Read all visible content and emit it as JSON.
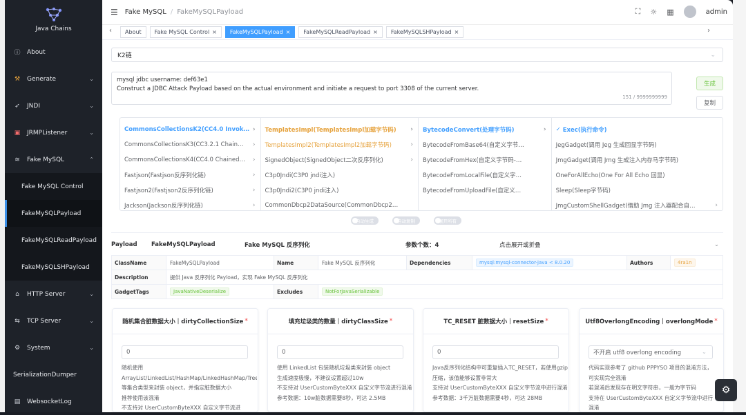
{
  "app": {
    "name": "Java Chains"
  },
  "sidebar": {
    "items": [
      {
        "label": "About",
        "icon": "info-circle-icon"
      },
      {
        "label": "Generate",
        "icon": "hammer-icon"
      },
      {
        "label": "JNDI",
        "icon": "rocket-icon"
      },
      {
        "label": "JRMPListener",
        "icon": "doc-icon"
      },
      {
        "label": "Fake MySQL",
        "icon": "mysql-icon"
      }
    ],
    "fake_mysql_sub": [
      "Fake MySQL Control",
      "FakeMySQLPayload",
      "FakeMySQLReadPayload",
      "FakeMySQLSHPayload"
    ],
    "items2": [
      {
        "label": "HTTP Server",
        "icon": "server-icon"
      },
      {
        "label": "TCP Server",
        "icon": "tcp-icon"
      },
      {
        "label": "System",
        "icon": "gear-icon"
      }
    ],
    "serialization": "SerializationDumper",
    "websocket": "WebsocketLog"
  },
  "header": {
    "crumb1": "Fake MySQL",
    "sep": "/",
    "crumb2": "FakeMySQLPayload",
    "user": "admin"
  },
  "tabs": [
    {
      "label": "About",
      "closable": false
    },
    {
      "label": "Fake MySQL Control",
      "closable": true
    },
    {
      "label": "FakeMySQLPayload",
      "closable": true
    },
    {
      "label": "FakeMySQLReadPayload",
      "closable": true
    },
    {
      "label": "FakeMySQLSHPayload",
      "closable": true
    }
  ],
  "chain_select": "K2链",
  "textarea": {
    "line1": "mysql jdbc username: def63e1",
    "line2": "Construct a JDBC Attack Payload based on the actual environment and initiate a request to port 3308 of the current server.",
    "counter": "151 / 9999999999"
  },
  "buttons": {
    "generate": "生成",
    "copy": "复制"
  },
  "cascader": {
    "col1": [
      "CommonsCollectionsK2(CC4.0 Invok…",
      "CommonsCollectionsK3(CC3.2.1 Chain…",
      "CommonsCollectionsK4(CC4.0 Chained…",
      "Fastjson(Fastjson反序列化链)",
      "Fastjson2(Fastjson2反序列化链)",
      "Jackson(Jackson反序列化链)"
    ],
    "col2": [
      "TemplatesImpl(TemplatesImpl加载字节码)",
      "TemplatesImpl2(TemplatesImpl2加载字节码)",
      "SignedObject(SignedObject二次反序列化)",
      "C3p0Jndi(C3P0 jndi注入)",
      "C3p0Jndi2(C3P0 jndi注入)",
      "CommonDbcp2DataSource(CommonDbcp2…"
    ],
    "col3": [
      "BytecodeConvert(处理字节码)",
      "BytecodeFromBase64(自定义字节…",
      "BytecodeFromHex(自定义字节码-…",
      "BytecodeFromLocalFile(自定义字…",
      "BytecodeFromUploadFile(自定义…"
    ],
    "col4": [
      "Exec(执行命令)",
      "JegGadget(调用 Jeg 生成回显字节码)",
      "JmgGadget(调用 Jmg 生成注入内存马字节码)",
      "OneForAllEcho(One For All Echo 回显)",
      "Sleep(Sleep字节码)",
      "JmgCustomShellGadget(借助 Jmg 注入器配合自…"
    ]
  },
  "switches": [
    "自动生成",
    "自动复制",
    "展开所有"
  ],
  "payload_head": {
    "payload_k": "Payload",
    "payload_v": "FakeMySQLPayload",
    "desc": "Fake MySQL 反序列化",
    "params": "参数个数：4",
    "toggle": "点击展开或折叠"
  },
  "desc_table": {
    "classname_k": "ClassName",
    "classname_v": "FakeMySQLPayload",
    "name_k": "Name",
    "name_v": "Fake MySQL 反序列化",
    "deps_k": "Dependencies",
    "deps_v": "mysql:mysql-connector-java < 8.0.20",
    "authors_k": "Authors",
    "authors_v": "4ra1n",
    "description_k": "Description",
    "description_v": "提供 Java 反序列化 Payload，实现 Fake MySQL 反序列化",
    "gadgettags_k": "GadgetTags",
    "gadgettags_v": "JavaNativeDeserialize",
    "excludes_k": "Excludes",
    "excludes_v": "NotForJavaSerializable"
  },
  "cards": [
    {
      "title": "随机集合脏数据大小｜dirtyCollectionSize",
      "value": "0",
      "text": "随机使用\nArrayList/LinkedList/HashMap/LinkedHashMap/TreeMap\n等集合类型来封装 object，并指定脏数据大小\n推荐使用该混淆\n不支持对 UserCustomByteXXX 自定义字节流进"
    },
    {
      "title": "填充垃圾类的数量｜dirtyClassSize",
      "value": "0",
      "text": "使用 LinkedList 包装随机垃圾类来封装 object\n生成速度极慢，不建议设置超过10w\n不支持对 UserCustomByteXXX 自定义字节流进行混淆\n参考数据：10w脏数据需要8秒，可达 2.5MB"
    },
    {
      "title": "TC_RESET 脏数据大小｜resetSize",
      "value": "0",
      "text": "Java反序列化结构中可重复插入TC_RESET，若使用gzip压缩，该值能够设置非常大\n支持对 UserCustomByteXXX 自定义字节流中进行混淆\n参考数据：3千万脏数据需要4秒，可达 28MB"
    },
    {
      "title": "Utf8OverlongEncoding｜overlongMode",
      "value": "不开启 utf8 overlong encoding",
      "text": "代码实现参考了 github PPPYSO 项目的混淆方法，可实现完全混淆\n若混淆后发现存在明文字符串，一般为字节码\n支持在 UserCustomByteXXX 自定义字节流中进行混淆"
    }
  ]
}
